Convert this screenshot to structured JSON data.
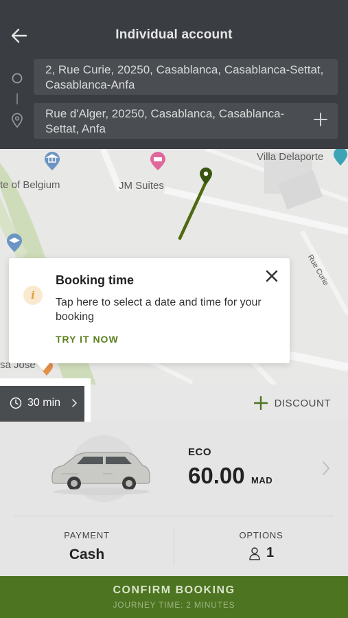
{
  "header": {
    "title": "Individual account",
    "back_icon": "arrow-left-icon",
    "pickup": {
      "address": "2, Rue Curie, 20250, Casablanca, Casablanca-Settat, Casablanca-Anfa"
    },
    "dropoff": {
      "address": "Rue d'Alger, 20250, Casablanca, Casablanca-Settat, Anfa"
    }
  },
  "map": {
    "labels": {
      "belgium": "te of Belgium",
      "jm_suites": "JM Suites",
      "villa": "Villa Delaporte",
      "rue_curie": "Rue Curie",
      "josef": "sa Jose"
    }
  },
  "tooltip": {
    "title": "Booking time",
    "text": "Tap here to select a date and time for your booking",
    "action": "TRY IT NOW"
  },
  "time_selector": {
    "value": "30 min"
  },
  "discount": {
    "label": "DISCOUNT"
  },
  "vehicle": {
    "category": "ECO",
    "price": "60.00",
    "currency": "MAD"
  },
  "payment": {
    "label": "PAYMENT",
    "value": "Cash"
  },
  "options": {
    "label": "OPTIONS",
    "value": "1"
  },
  "confirm": {
    "label": "CONFIRM BOOKING",
    "subtitle": "JOURNEY TIME: 2 MINUTES"
  },
  "colors": {
    "header_bg": "#3a3e42",
    "accent_green": "#4d7420",
    "route_green": "#4e6a10"
  }
}
